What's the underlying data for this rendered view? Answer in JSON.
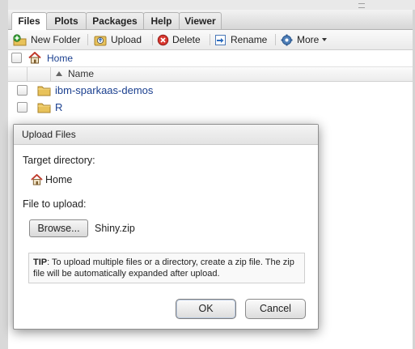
{
  "tabs": [
    {
      "label": "Files",
      "active": true
    },
    {
      "label": "Plots",
      "active": false
    },
    {
      "label": "Packages",
      "active": false
    },
    {
      "label": "Help",
      "active": false
    },
    {
      "label": "Viewer",
      "active": false
    }
  ],
  "toolbar": {
    "new_folder": "New Folder",
    "upload": "Upload",
    "delete": "Delete",
    "rename": "Rename",
    "more": "More"
  },
  "path": {
    "home_label": "Home"
  },
  "file_list": {
    "column_name": "Name",
    "sort": "ascending",
    "items": [
      {
        "name": "ibm-sparkaas-demos",
        "type": "folder"
      },
      {
        "name": "R",
        "type": "folder"
      }
    ]
  },
  "dialog": {
    "title": "Upload Files",
    "target_label": "Target directory:",
    "target_value": "Home",
    "file_label": "File to upload:",
    "browse_label": "Browse...",
    "chosen_file": "Shiny.zip",
    "tip_bold": "TIP",
    "tip_text": ": To upload multiple files or a directory, create a zip file. The zip file will be automatically expanded after upload.",
    "ok_label": "OK",
    "cancel_label": "Cancel"
  },
  "icons": {
    "new_folder": "new-folder-icon",
    "upload": "upload-icon",
    "delete": "delete-icon",
    "rename": "rename-icon",
    "more": "gear-icon",
    "home": "home-icon",
    "folder": "folder-icon"
  },
  "colors": {
    "link": "#1a3f8f",
    "folder": "#e8c25a",
    "delete_red": "#c62828",
    "home_roof": "#c0392b"
  }
}
